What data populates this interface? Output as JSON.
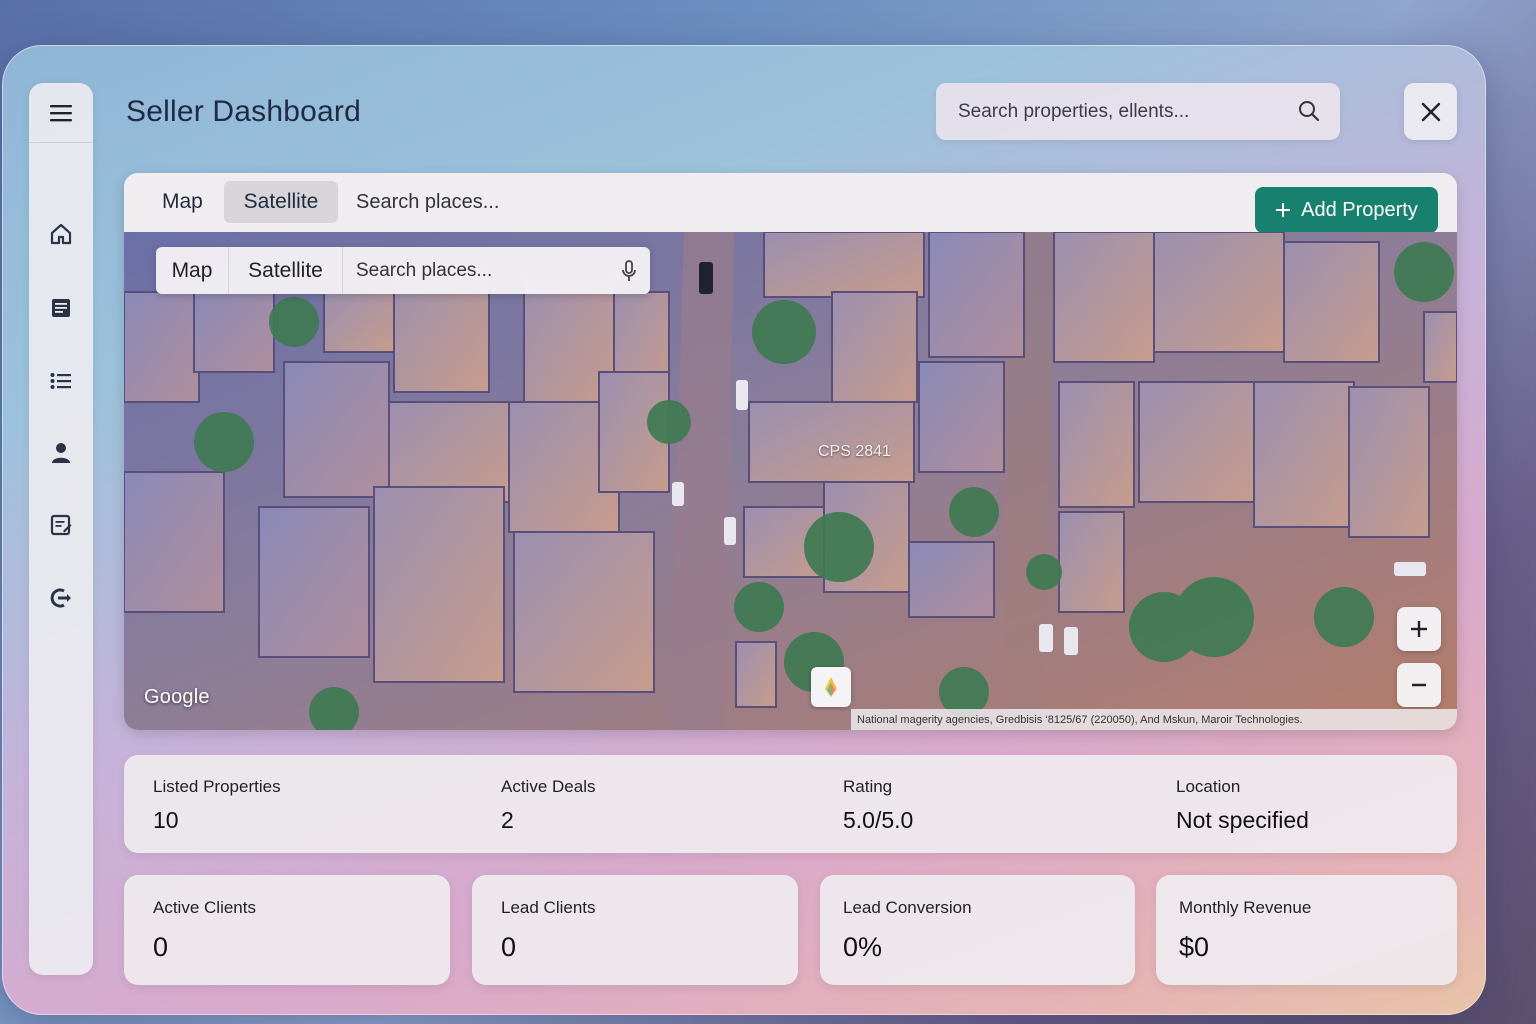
{
  "app": {
    "title": "Seller Dashboard"
  },
  "search": {
    "placeholder": "Search properties, ellents..."
  },
  "sidebar": {
    "items": [
      {
        "name": "home",
        "icon": "home-icon"
      },
      {
        "name": "documents",
        "icon": "document-icon"
      },
      {
        "name": "list",
        "icon": "list-icon"
      },
      {
        "name": "profile",
        "icon": "user-icon"
      },
      {
        "name": "notes",
        "icon": "edit-note-icon"
      },
      {
        "name": "logout",
        "icon": "logout-icon"
      }
    ]
  },
  "map": {
    "tabs": [
      "Map",
      "Satellite"
    ],
    "active_tab": "Satellite",
    "search_placeholder": "Search places...",
    "add_button": "Add Property",
    "inner_tabs": [
      "Map",
      "Satellite"
    ],
    "inner_search_placeholder": "Search places...",
    "place_label": "CPS 2841",
    "google_label": "Google",
    "attribution": "National magerity agencies, Gredbisis ‘8125/67 (220050), And Mskun, Maroir Technologies.",
    "accent_color": "#17806e"
  },
  "stats": [
    {
      "label": "Listed Properties",
      "value": "10"
    },
    {
      "label": "Active Deals",
      "value": "2"
    },
    {
      "label": "Rating",
      "value": "5.0/5.0"
    },
    {
      "label": "Location",
      "value": "Not specified"
    }
  ],
  "cards": [
    {
      "label": "Active Clients",
      "value": "0"
    },
    {
      "label": "Lead Clients",
      "value": "0"
    },
    {
      "label": "Lead Conversion",
      "value": "0%"
    },
    {
      "label": "Monthly Revenue",
      "value": "$0"
    }
  ]
}
